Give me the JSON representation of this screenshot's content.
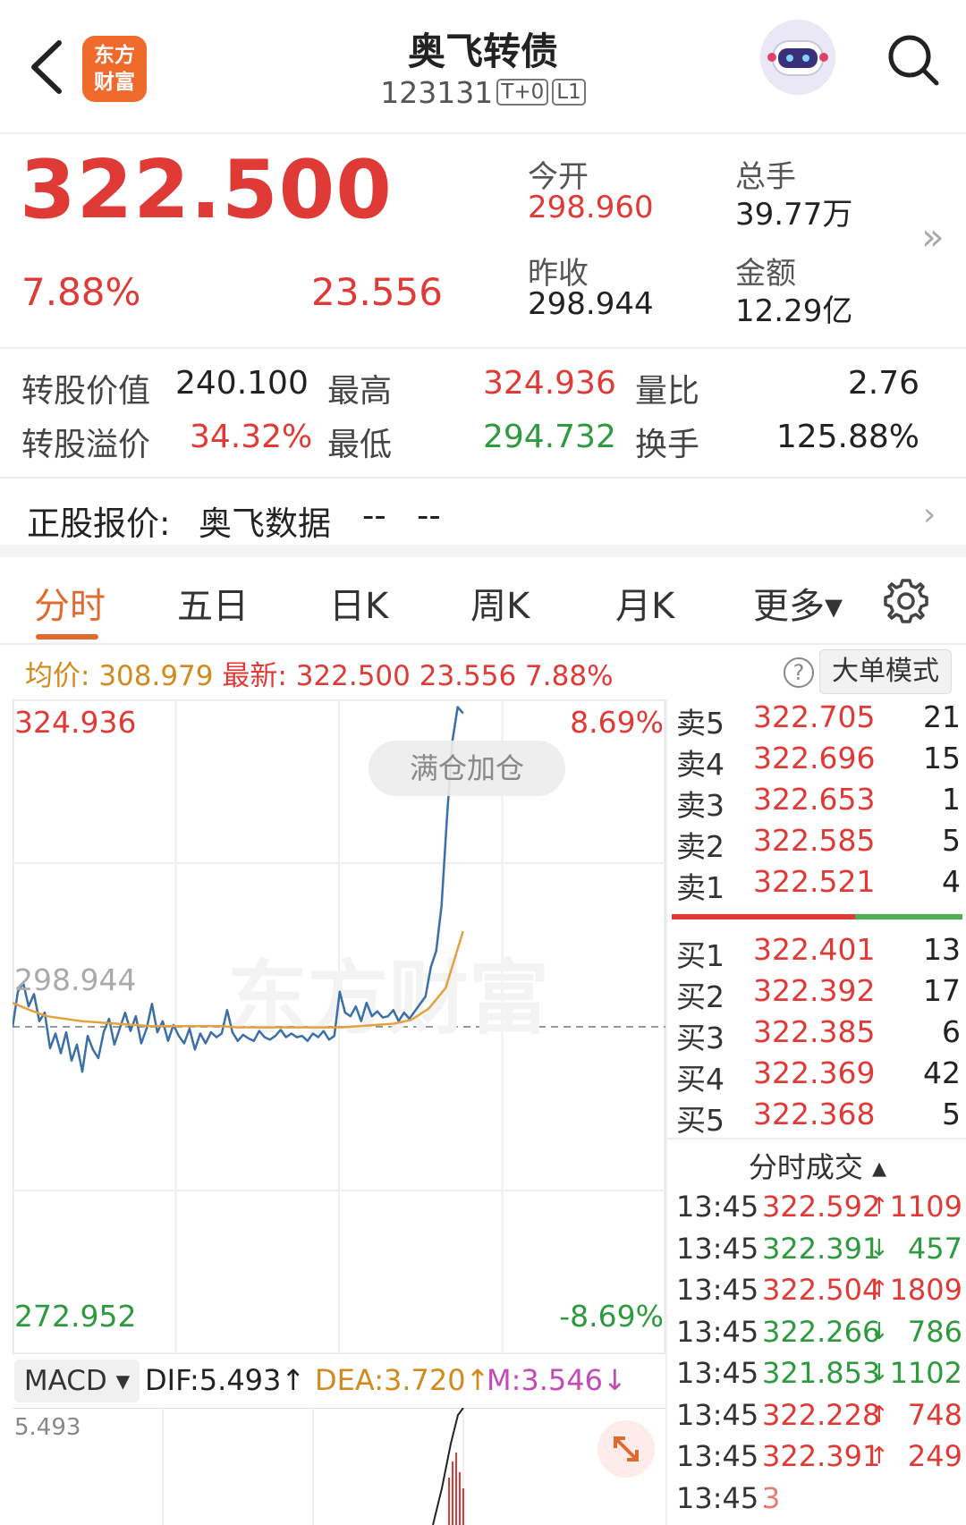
{
  "header": {
    "back_icon": "back-chevron-icon",
    "logo_line1": "东方",
    "logo_line2": "财富",
    "name": "奥飞转债",
    "code": "123131",
    "tags": [
      "T+0",
      "L1"
    ],
    "avatar_icon": "robot-assistant-icon",
    "search_icon": "search-icon"
  },
  "quote": {
    "price": "322.500",
    "change_pct": "7.88%",
    "change": "23.556",
    "open_label": "今开",
    "open": "298.960",
    "volume_label": "总手",
    "volume": "39.77万",
    "prev_close_label": "昨收",
    "prev_close": "298.944",
    "amount_label": "金额",
    "amount": "12.29亿",
    "more_icon": "double-chevron-right-icon"
  },
  "stats": {
    "conv_value_label": "转股价值",
    "conv_value": "240.100",
    "high_label": "最高",
    "high": "324.936",
    "vol_ratio_label": "量比",
    "vol_ratio": "2.76",
    "premium_label": "转股溢价",
    "premium": "34.32%",
    "low_label": "最低",
    "low": "294.732",
    "turnover_label": "换手",
    "turnover": "125.88%"
  },
  "underlying": {
    "label": "正股报价:",
    "name": "奥飞数据",
    "price": "--",
    "change": "--"
  },
  "tabs": [
    {
      "label": "分时"
    },
    {
      "label": "五日"
    },
    {
      "label": "日K"
    },
    {
      "label": "周K"
    },
    {
      "label": "月K"
    },
    {
      "label": "更多▾"
    }
  ],
  "info": {
    "avg_label": "均价:",
    "avg": "308.979",
    "latest_label": "最新:",
    "latest": "322.500 23.556 7.88%",
    "help": "?",
    "big_order_mode": "大单模式"
  },
  "chart_labels": {
    "top_price": "324.936",
    "top_pct": "8.69%",
    "bottom_price": "272.952",
    "bottom_pct": "-8.69%",
    "ref_price": "298.944",
    "watermark": "东方财富",
    "full_position": "满仓加仓"
  },
  "chart_data": {
    "type": "line",
    "title": "",
    "ylim": [
      272.952,
      324.936
    ],
    "reference": 298.944,
    "colors": {
      "price": "#3a6fa8",
      "avg": "#e2a33e"
    },
    "series": [
      {
        "values": [
          298.9,
          301.8,
          302.5,
          300.6,
          301.6,
          299.4,
          300.1,
          297.2,
          298.4,
          296.8,
          298.5,
          296.2,
          297.5,
          295.3,
          298.2,
          297.1,
          296.4,
          298.5,
          299.6,
          297.5,
          298.8,
          300.1,
          298.6,
          299.8,
          297.6,
          298.8,
          300.8,
          298.5,
          299.4,
          297.8,
          299.1,
          298.2,
          297.6,
          298.8,
          297.1,
          298.4,
          297.6,
          298.5,
          298.1,
          298.4,
          300.3,
          298.5,
          297.8,
          298.3,
          298.0,
          297.8,
          298.6,
          298.1,
          297.9,
          298.2,
          298.7,
          298.1,
          298.4,
          298.1,
          298.2,
          297.8,
          298.4,
          298.1,
          298.6,
          297.9,
          298.2,
          301.8,
          300.1,
          299.8,
          300.6,
          299.4,
          300.9,
          299.8,
          300.2,
          299.7,
          299.8,
          300.3,
          299.4,
          300.1,
          299.6,
          300.2,
          300.8,
          301.4,
          303.8,
          305.1,
          308.8,
          315.9,
          322.1,
          324.9,
          324.4
        ],
        "x_end_fraction": 0.69
      },
      {
        "values": [
          300.9,
          300.3,
          299.8,
          299.6,
          299.4,
          299.3,
          299.2,
          299.1,
          299.0,
          299.0,
          299.0,
          299.0,
          299.0,
          298.9,
          298.9,
          298.9,
          298.9,
          298.9,
          298.9,
          298.9,
          299.0,
          299.1,
          299.2,
          299.5,
          300.4,
          302.1,
          306.7
        ],
        "x_end_fraction": 0.69
      }
    ]
  },
  "macd": {
    "selector": "MACD ▾",
    "dif": "DIF:5.493↑",
    "dea": "DEA:3.720↑",
    "m": "M:3.546↓",
    "axis_top": "5.493",
    "expand_icon": "expand-arrows-icon"
  },
  "book": {
    "asks": [
      {
        "label": "卖5",
        "price": "322.705",
        "vol": "21"
      },
      {
        "label": "卖4",
        "price": "322.696",
        "vol": "15"
      },
      {
        "label": "卖3",
        "price": "322.653",
        "vol": "1"
      },
      {
        "label": "卖2",
        "price": "322.585",
        "vol": "5"
      },
      {
        "label": "卖1",
        "price": "322.521",
        "vol": "4"
      }
    ],
    "bids": [
      {
        "label": "买1",
        "price": "322.401",
        "vol": "13"
      },
      {
        "label": "买2",
        "price": "322.392",
        "vol": "17"
      },
      {
        "label": "买3",
        "price": "322.385",
        "vol": "6"
      },
      {
        "label": "买4",
        "price": "322.369",
        "vol": "42"
      },
      {
        "label": "买5",
        "price": "322.368",
        "vol": "5"
      }
    ],
    "ticks_title": "分时成交 ▴",
    "ticks": [
      {
        "time": "13:45",
        "price": "322.592",
        "dir": "↑",
        "vol": "1109",
        "color": "#e03a36"
      },
      {
        "time": "13:45",
        "price": "322.391",
        "dir": "↓",
        "vol": "457",
        "color": "#2e9a3e"
      },
      {
        "time": "13:45",
        "price": "322.504",
        "dir": "↑",
        "vol": "1809",
        "color": "#e03a36"
      },
      {
        "time": "13:45",
        "price": "322.266",
        "dir": "↓",
        "vol": "786",
        "color": "#2e9a3e"
      },
      {
        "time": "13:45",
        "price": "321.853",
        "dir": "↓",
        "vol": "1102",
        "color": "#2e9a3e"
      },
      {
        "time": "13:45",
        "price": "322.228",
        "dir": "↑",
        "vol": "748",
        "color": "#e03a36"
      },
      {
        "time": "13:45",
        "price": "322.391",
        "dir": "↑",
        "vol": "249",
        "color": "#e03a36"
      },
      {
        "time": "13:45",
        "price": "3",
        "dir": "",
        "vol": "",
        "color": "#e03a36"
      }
    ]
  }
}
